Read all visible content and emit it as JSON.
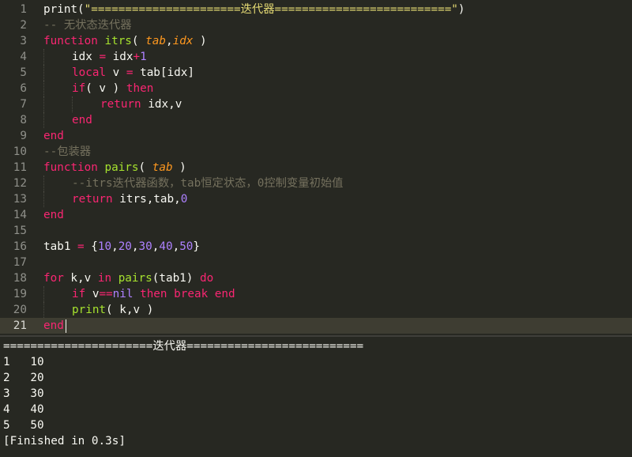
{
  "colors": {
    "background": "#272822",
    "foreground": "#f8f8f2",
    "keyword": "#f92672",
    "function": "#a6e22e",
    "parameter": "#fd971f",
    "string": "#e6db74",
    "number": "#ae81ff",
    "comment": "#75715e",
    "gutter": "#8f908a"
  },
  "editor": {
    "current_line": 21,
    "lines": [
      {
        "num": "1",
        "tokens": [
          [
            "print(",
            "foreground"
          ],
          [
            "\"======================迭代器==========================\"",
            "string"
          ],
          [
            ")",
            "foreground"
          ]
        ]
      },
      {
        "num": "2",
        "tokens": [
          [
            "-- 无状态迭代器",
            "comment"
          ]
        ]
      },
      {
        "num": "3",
        "tokens": [
          [
            "function",
            "keyword"
          ],
          [
            " ",
            "foreground"
          ],
          [
            "itrs",
            "function"
          ],
          [
            "( ",
            "foreground"
          ],
          [
            "tab",
            "parameter"
          ],
          [
            ",",
            "foreground"
          ],
          [
            "idx",
            "parameter"
          ],
          [
            " )",
            "foreground"
          ]
        ]
      },
      {
        "num": "4",
        "indent": 1,
        "tokens": [
          [
            "idx ",
            "foreground"
          ],
          [
            "=",
            "keyword"
          ],
          [
            " idx",
            "foreground"
          ],
          [
            "+",
            "keyword"
          ],
          [
            "1",
            "number"
          ]
        ]
      },
      {
        "num": "5",
        "indent": 1,
        "tokens": [
          [
            "local",
            "keyword"
          ],
          [
            " v ",
            "foreground"
          ],
          [
            "=",
            "keyword"
          ],
          [
            " tab[idx]",
            "foreground"
          ]
        ]
      },
      {
        "num": "6",
        "indent": 1,
        "tokens": [
          [
            "if",
            "keyword"
          ],
          [
            "( v ) ",
            "foreground"
          ],
          [
            "then",
            "keyword"
          ]
        ]
      },
      {
        "num": "7",
        "indent": 2,
        "tokens": [
          [
            "return",
            "keyword"
          ],
          [
            " idx,v",
            "foreground"
          ]
        ]
      },
      {
        "num": "8",
        "indent": 1,
        "tokens": [
          [
            "end",
            "keyword"
          ]
        ]
      },
      {
        "num": "9",
        "tokens": [
          [
            "end",
            "keyword"
          ]
        ]
      },
      {
        "num": "10",
        "tokens": [
          [
            "--包装器",
            "comment"
          ]
        ]
      },
      {
        "num": "11",
        "tokens": [
          [
            "function",
            "keyword"
          ],
          [
            " ",
            "foreground"
          ],
          [
            "pairs",
            "function"
          ],
          [
            "( ",
            "foreground"
          ],
          [
            "tab",
            "parameter"
          ],
          [
            " )",
            "foreground"
          ]
        ]
      },
      {
        "num": "12",
        "indent": 1,
        "tokens": [
          [
            "--itrs迭代器函数，tab恒定状态，0控制变量初始值",
            "comment"
          ]
        ]
      },
      {
        "num": "13",
        "indent": 1,
        "tokens": [
          [
            "return",
            "keyword"
          ],
          [
            " itrs,tab,",
            "foreground"
          ],
          [
            "0",
            "number"
          ]
        ]
      },
      {
        "num": "14",
        "tokens": [
          [
            "end",
            "keyword"
          ]
        ]
      },
      {
        "num": "15",
        "tokens": []
      },
      {
        "num": "16",
        "tokens": [
          [
            "tab1 ",
            "foreground"
          ],
          [
            "=",
            "keyword"
          ],
          [
            " {",
            "foreground"
          ],
          [
            "10",
            "number"
          ],
          [
            ",",
            "foreground"
          ],
          [
            "20",
            "number"
          ],
          [
            ",",
            "foreground"
          ],
          [
            "30",
            "number"
          ],
          [
            ",",
            "foreground"
          ],
          [
            "40",
            "number"
          ],
          [
            ",",
            "foreground"
          ],
          [
            "50",
            "number"
          ],
          [
            "}",
            "foreground"
          ]
        ]
      },
      {
        "num": "17",
        "tokens": []
      },
      {
        "num": "18",
        "tokens": [
          [
            "for",
            "keyword"
          ],
          [
            " k,v ",
            "foreground"
          ],
          [
            "in",
            "keyword"
          ],
          [
            " ",
            "foreground"
          ],
          [
            "pairs",
            "function"
          ],
          [
            "(tab1) ",
            "foreground"
          ],
          [
            "do",
            "keyword"
          ]
        ]
      },
      {
        "num": "19",
        "indent": 1,
        "tokens": [
          [
            "if",
            "keyword"
          ],
          [
            " v",
            "foreground"
          ],
          [
            "==",
            "keyword"
          ],
          [
            "nil",
            "number"
          ],
          [
            " ",
            "foreground"
          ],
          [
            "then",
            "keyword"
          ],
          [
            " ",
            "foreground"
          ],
          [
            "break",
            "keyword"
          ],
          [
            " ",
            "foreground"
          ],
          [
            "end",
            "keyword"
          ]
        ]
      },
      {
        "num": "20",
        "indent": 1,
        "tokens": [
          [
            "print",
            "function"
          ],
          [
            "( k,v )",
            "foreground"
          ]
        ]
      },
      {
        "num": "21",
        "tokens": [
          [
            "end",
            "keyword"
          ]
        ]
      }
    ]
  },
  "console": {
    "lines": [
      "======================迭代器==========================",
      "1   10",
      "2   20",
      "3   30",
      "4   40",
      "5   50",
      "[Finished in 0.3s]"
    ]
  }
}
